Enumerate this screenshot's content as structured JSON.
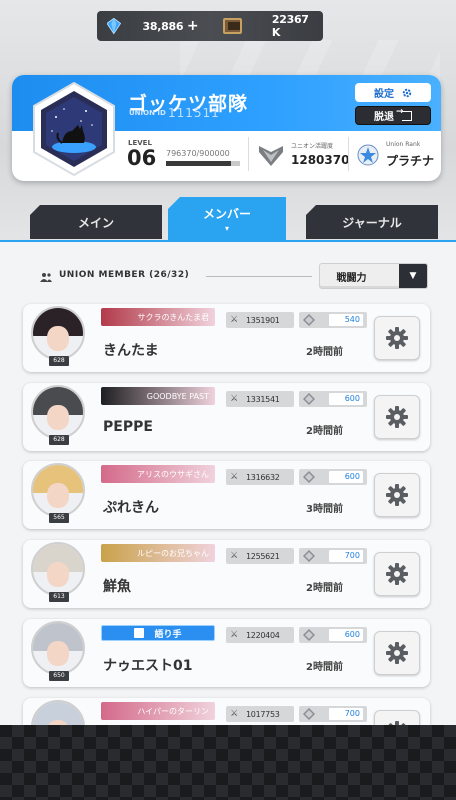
{
  "currency": {
    "gems": "38,886",
    "plus": "+",
    "credits": "22367 K"
  },
  "union": {
    "name": "ゴッケツ部隊",
    "id_label": "UNION ID",
    "id": "111511",
    "settings_label": "設定",
    "leave_label": "脱退",
    "level_label": "LEVEL",
    "level": "06",
    "exp": "796370/900000",
    "exp_fraction": 0.885,
    "activity_label": "ユニオン活躍度",
    "activity": "1280370",
    "rank_label": "Union Rank",
    "rank": "プラチナ"
  },
  "tabs": [
    {
      "label": "メイン",
      "active": false
    },
    {
      "label": "メンバー",
      "active": true,
      "caret": "▾"
    },
    {
      "label": "ジャーナル",
      "active": false
    }
  ],
  "members_header": {
    "title": "UNION MEMBER (26/32)",
    "sort_label": "戦闘力",
    "sort_chevron": "▼"
  },
  "members": [
    {
      "banner": "サクラのきんたま君",
      "name": "きんたま",
      "level": "628",
      "power": "1351901",
      "contribution": "540",
      "last_login": "2時間前",
      "banner_color": "#b23a4a",
      "hair": "#2a2226"
    },
    {
      "banner": "GOODBYE PAST",
      "name": "PEPPE",
      "level": "628",
      "power": "1331541",
      "contribution": "600",
      "last_login": "2時間前",
      "banner_color": "#1e1f22",
      "hair": "#4a4b4f"
    },
    {
      "banner": "アリスのウサギさん",
      "name": "ぷれきん",
      "level": "565",
      "power": "1316632",
      "contribution": "600",
      "last_login": "3時間前",
      "banner_color": "#d46a8a",
      "hair": "#e6c27a"
    },
    {
      "banner": "ルピーのお兄ちゃん",
      "name": "鮮魚",
      "level": "613",
      "power": "1255621",
      "contribution": "700",
      "last_login": "2時間前",
      "banner_color": "#c9a24a",
      "hair": "#d9d4cc"
    },
    {
      "banner": "語り手",
      "name": "ナゥエスト01",
      "level": "650",
      "power": "1220404",
      "contribution": "600",
      "last_login": "2時間前",
      "banner_color": "#2a8ff0",
      "hair": "#bfc3cc",
      "narrator": true
    },
    {
      "banner": "ハイパーのターリン",
      "name": "",
      "level": "",
      "power": "1017753",
      "contribution": "700",
      "last_login": "",
      "banner_color": "#d46a8a",
      "hair": "#c8d0dc"
    }
  ],
  "colors": {
    "accent": "#2aa3f0",
    "union_blue": "#1d8ef0",
    "dark": "#2c2f35"
  }
}
